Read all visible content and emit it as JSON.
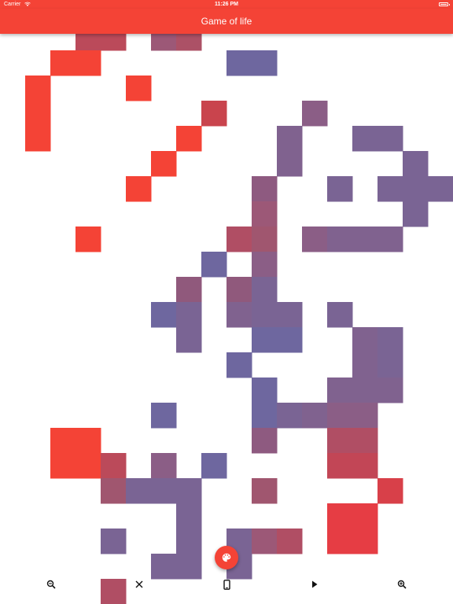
{
  "status_bar": {
    "carrier": "Carrier",
    "time": "11:26 PM"
  },
  "app_bar": {
    "title": "Game of life"
  },
  "colors": {
    "accent": "#f44336",
    "alive_old": "#f44336",
    "alive_young": "#6e679f"
  },
  "icons": {
    "fab": "palette-icon",
    "bottom_bar": [
      "zoom-out-icon",
      "close-icon",
      "phone-icon",
      "play-icon",
      "zoom-in-icon"
    ]
  },
  "grid": {
    "columns": 18,
    "rows": 24,
    "cells": [
      [
        3,
        1,
        "#bb4a5a"
      ],
      [
        4,
        1,
        "#bb4a5a"
      ],
      [
        6,
        1,
        "#9c5877"
      ],
      [
        7,
        1,
        "#ac5166"
      ],
      [
        2,
        2,
        "#f44336"
      ],
      [
        3,
        2,
        "#f44336"
      ],
      [
        9,
        2,
        "#6e679f"
      ],
      [
        10,
        2,
        "#6e679f"
      ],
      [
        1,
        3,
        "#f44336"
      ],
      [
        5,
        3,
        "#f44336"
      ],
      [
        1,
        4,
        "#f44336"
      ],
      [
        8,
        4,
        "#c9444d"
      ],
      [
        12,
        4,
        "#8b5e86"
      ],
      [
        1,
        5,
        "#f44336"
      ],
      [
        7,
        5,
        "#f44336"
      ],
      [
        11,
        5,
        "#80628f"
      ],
      [
        14,
        5,
        "#7a6494"
      ],
      [
        15,
        5,
        "#7a6494"
      ],
      [
        6,
        6,
        "#f44336"
      ],
      [
        11,
        6,
        "#80628f"
      ],
      [
        16,
        6,
        "#7a6494"
      ],
      [
        5,
        7,
        "#f44336"
      ],
      [
        10,
        7,
        "#8e5a80"
      ],
      [
        13,
        7,
        "#7a6494"
      ],
      [
        15,
        7,
        "#7a6494"
      ],
      [
        16,
        7,
        "#7a6494"
      ],
      [
        17,
        7,
        "#7a6494"
      ],
      [
        10,
        8,
        "#9c5877"
      ],
      [
        16,
        8,
        "#7a6494"
      ],
      [
        3,
        9,
        "#f44336"
      ],
      [
        9,
        9,
        "#b04e64"
      ],
      [
        10,
        9,
        "#a0566f"
      ],
      [
        12,
        9,
        "#8b5e86"
      ],
      [
        13,
        9,
        "#80628f"
      ],
      [
        14,
        9,
        "#80628f"
      ],
      [
        15,
        9,
        "#80628f"
      ],
      [
        8,
        10,
        "#6e679f"
      ],
      [
        10,
        10,
        "#8b5e86"
      ],
      [
        7,
        11,
        "#90597c"
      ],
      [
        9,
        11,
        "#90597c"
      ],
      [
        10,
        11,
        "#7a6494"
      ],
      [
        6,
        12,
        "#6e679f"
      ],
      [
        7,
        12,
        "#7a6494"
      ],
      [
        9,
        12,
        "#80628f"
      ],
      [
        10,
        12,
        "#7a6494"
      ],
      [
        11,
        12,
        "#7a6494"
      ],
      [
        13,
        12,
        "#7a6494"
      ],
      [
        7,
        13,
        "#7a6494"
      ],
      [
        10,
        13,
        "#6e679f"
      ],
      [
        11,
        13,
        "#6e679f"
      ],
      [
        14,
        13,
        "#80628f"
      ],
      [
        15,
        13,
        "#7a6494"
      ],
      [
        9,
        14,
        "#6e679f"
      ],
      [
        14,
        14,
        "#80628f"
      ],
      [
        15,
        14,
        "#7a6494"
      ],
      [
        10,
        15,
        "#6e679f"
      ],
      [
        13,
        15,
        "#80628f"
      ],
      [
        14,
        15,
        "#80628f"
      ],
      [
        15,
        15,
        "#80628f"
      ],
      [
        6,
        16,
        "#6e679f"
      ],
      [
        10,
        16,
        "#6e679f"
      ],
      [
        11,
        16,
        "#7a6494"
      ],
      [
        12,
        16,
        "#80628f"
      ],
      [
        13,
        16,
        "#8b5e86"
      ],
      [
        14,
        16,
        "#8b5e86"
      ],
      [
        2,
        17,
        "#f44336"
      ],
      [
        3,
        17,
        "#f44336"
      ],
      [
        10,
        17,
        "#8e5a80"
      ],
      [
        13,
        17,
        "#b04e64"
      ],
      [
        14,
        17,
        "#b04e64"
      ],
      [
        2,
        18,
        "#f44336"
      ],
      [
        3,
        18,
        "#f44336"
      ],
      [
        4,
        18,
        "#bb4a5a"
      ],
      [
        6,
        18,
        "#8b5e86"
      ],
      [
        8,
        18,
        "#6e679f"
      ],
      [
        13,
        18,
        "#c24656"
      ],
      [
        14,
        18,
        "#c24656"
      ],
      [
        4,
        19,
        "#a0566f"
      ],
      [
        5,
        19,
        "#7a6494"
      ],
      [
        6,
        19,
        "#7a6494"
      ],
      [
        7,
        19,
        "#7a6494"
      ],
      [
        10,
        19,
        "#a0566f"
      ],
      [
        15,
        19,
        "#d84049"
      ],
      [
        7,
        20,
        "#7a6494"
      ],
      [
        13,
        20,
        "#e63d44"
      ],
      [
        14,
        20,
        "#e63d44"
      ],
      [
        4,
        21,
        "#7a6494"
      ],
      [
        7,
        21,
        "#7a6494"
      ],
      [
        9,
        21,
        "#7a6494"
      ],
      [
        10,
        21,
        "#9c5877"
      ],
      [
        11,
        21,
        "#b04e64"
      ],
      [
        13,
        21,
        "#e63d44"
      ],
      [
        14,
        21,
        "#e63d44"
      ],
      [
        6,
        22,
        "#7a6494"
      ],
      [
        7,
        22,
        "#7a6494"
      ],
      [
        9,
        22,
        "#7a6494"
      ],
      [
        4,
        23,
        "#b04e64"
      ]
    ]
  }
}
